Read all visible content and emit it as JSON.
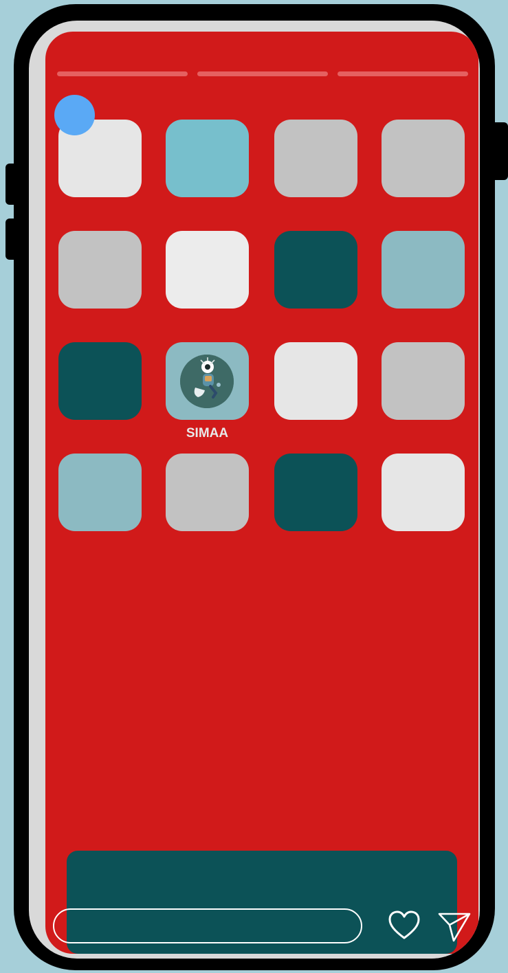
{
  "story": {
    "progress_segments": 3,
    "app_grid": {
      "rows": [
        [
          {
            "name": "tile-1-1",
            "color": "#e6e6e6",
            "label": ""
          },
          {
            "name": "tile-1-2",
            "color": "#77bfcc",
            "label": ""
          },
          {
            "name": "tile-1-3",
            "color": "#c2c2c2",
            "label": ""
          },
          {
            "name": "tile-1-4",
            "color": "#c2c2c2",
            "label": ""
          }
        ],
        [
          {
            "name": "tile-2-1",
            "color": "#c2c2c2",
            "label": ""
          },
          {
            "name": "tile-2-2",
            "color": "#ececec",
            "label": ""
          },
          {
            "name": "tile-2-3",
            "color": "#0c5257",
            "label": ""
          },
          {
            "name": "tile-2-4",
            "color": "#8cbac2",
            "label": ""
          }
        ],
        [
          {
            "name": "tile-3-1",
            "color": "#0c5257",
            "label": ""
          },
          {
            "name": "tile-3-2",
            "color": "#8cbac2",
            "label": "SIMAA",
            "icon": "simaa-app-icon"
          },
          {
            "name": "tile-3-3",
            "color": "#e6e6e6",
            "label": ""
          },
          {
            "name": "tile-3-4",
            "color": "#c2c2c2",
            "label": ""
          }
        ],
        [
          {
            "name": "tile-4-1",
            "color": "#8cbac2",
            "label": ""
          },
          {
            "name": "tile-4-2",
            "color": "#c2c2c2",
            "label": ""
          },
          {
            "name": "tile-4-3",
            "color": "#0c5257",
            "label": ""
          },
          {
            "name": "tile-4-4",
            "color": "#e6e6e6",
            "label": ""
          }
        ]
      ]
    },
    "reply": {
      "placeholder": ""
    }
  },
  "colors": {
    "page_background": "#a6cfd9",
    "screen_background": "#d11a1a",
    "progress_segment": "#e56060",
    "avatar": "#5aa9f5",
    "dock": "#0c5257"
  },
  "icons": {
    "like": "heart-icon",
    "share": "send-icon"
  }
}
